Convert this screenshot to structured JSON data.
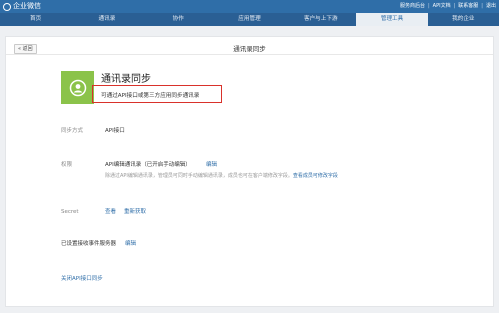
{
  "topbar": {
    "brand": "企业微信",
    "links": [
      "服务商后台",
      "API文档",
      "联系客服",
      "退出"
    ]
  },
  "nav": {
    "items": [
      "首页",
      "通讯录",
      "协作",
      "应用管理",
      "客户与上下游",
      "管理工具",
      "我的企业"
    ],
    "active_index": 5
  },
  "page": {
    "back_label": "« 返回",
    "title": "通讯录同步"
  },
  "app": {
    "name": "通讯录同步",
    "description": "可通过API接口或第三方应用同步通讯录",
    "logo_color": "#8bc34a"
  },
  "settings": {
    "sync_method": {
      "label": "同步方式",
      "value": "API接口"
    },
    "permission": {
      "label": "权限",
      "value": "API编辑通讯录（已开启手动编辑）",
      "edit_link": "编辑",
      "note_prefix": "除通过API编辑通讯录，管理员可同时手动编辑通讯录，成员也可在客户端修改字段。",
      "note_link": "查看成员可修改字段"
    },
    "secret": {
      "label": "Secret",
      "view_link": "查看",
      "refresh_link": "重新获取"
    },
    "event_server": {
      "label": "已设置接收事件服务器",
      "edit_link": "编辑"
    },
    "disable_link": "关闭API接口同步"
  },
  "colors": {
    "primary": "#2f6ea8",
    "highlight_border": "#d9322b"
  }
}
